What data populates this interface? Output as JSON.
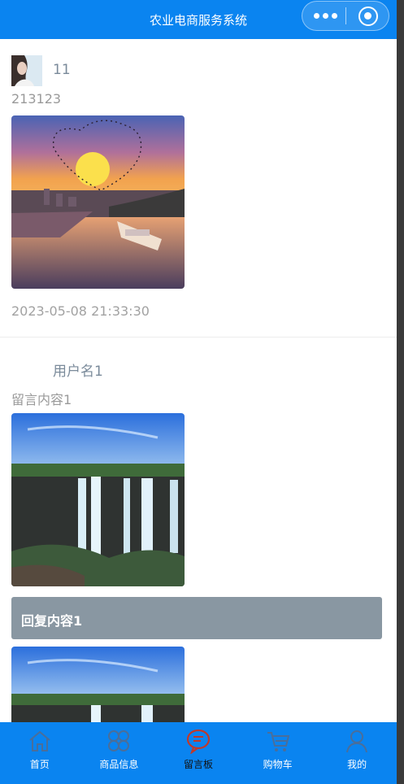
{
  "header": {
    "title": "农业电商服务系统"
  },
  "messages": [
    {
      "username": "11",
      "content": "213123",
      "time": "2023-05-08 21:33:30"
    },
    {
      "username": "用户名1",
      "content": "留言内容1",
      "reply": "回复内容1"
    }
  ],
  "tabbar": [
    {
      "label": "首页",
      "icon": "home-icon"
    },
    {
      "label": "商品信息",
      "icon": "grid-icon"
    },
    {
      "label": "留言板",
      "icon": "message-icon"
    },
    {
      "label": "购物车",
      "icon": "cart-icon"
    },
    {
      "label": "我的",
      "icon": "user-icon"
    }
  ],
  "colors": {
    "accent": "#0a84f0",
    "reply_bg": "#8997a2",
    "active_icon": "#c0392b"
  }
}
